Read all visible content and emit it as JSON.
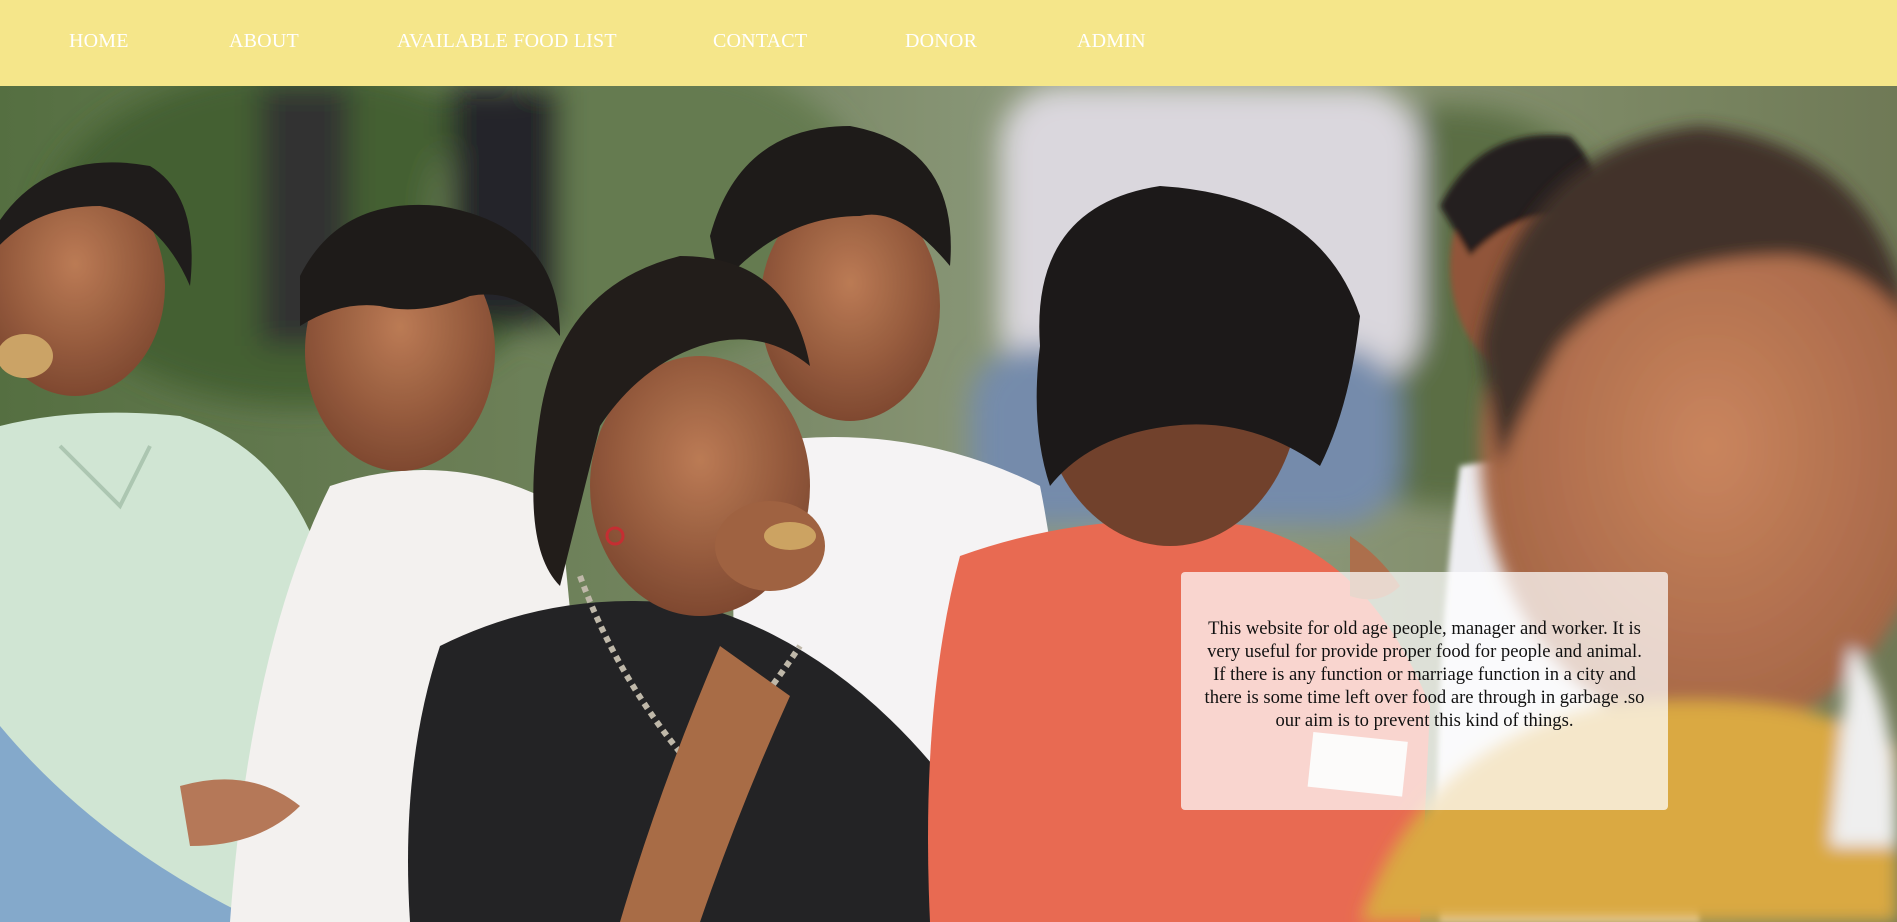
{
  "nav": {
    "home": "HOME",
    "about": "ABOUT",
    "food_list": "AVAILABLE FOOD LIST",
    "contact": "CONTACT",
    "donor": "DONOR",
    "admin": "ADMIN"
  },
  "info_box": {
    "text": "This website for old age people, manager and worker. It is very useful for provide proper food for people and animal. If there is any function or marriage function in a city and there is some time left over food are through in garbage .so our aim is to prevent this kind of things."
  },
  "colors": {
    "navbar_bg": "#f5e68a",
    "nav_text": "#ffffff"
  }
}
